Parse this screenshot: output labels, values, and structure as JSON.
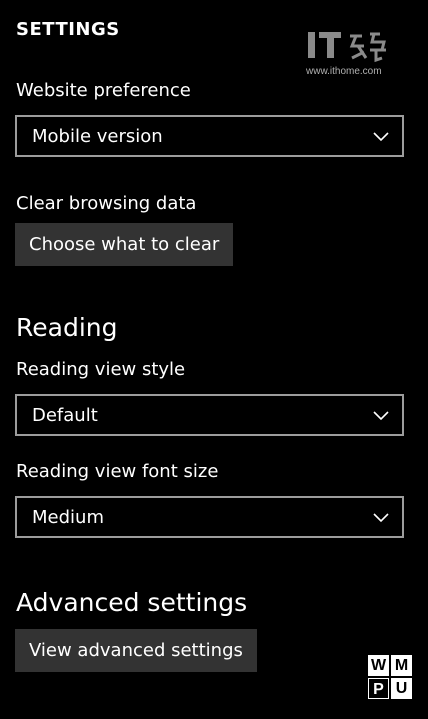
{
  "header": {
    "title": "SETTINGS"
  },
  "watermark": {
    "logo_text": "IT之家",
    "url": "www.ithome.com",
    "corner_badge": [
      "W",
      "M",
      "P",
      "U"
    ]
  },
  "website_preference": {
    "label": "Website preference",
    "value": "Mobile version"
  },
  "clear_browsing_data": {
    "label": "Clear browsing data",
    "button_label": "Choose what to clear"
  },
  "reading": {
    "heading": "Reading",
    "style_label": "Reading view style",
    "style_value": "Default",
    "font_size_label": "Reading view font size",
    "font_size_value": "Medium"
  },
  "advanced": {
    "heading": "Advanced settings",
    "button_label": "View advanced settings"
  },
  "icons": {
    "dropdown": "chevron-down-icon"
  },
  "colors": {
    "background": "#000000",
    "text": "#ffffff",
    "button_bg": "#333333",
    "dropdown_border": "#9c9c9c"
  }
}
